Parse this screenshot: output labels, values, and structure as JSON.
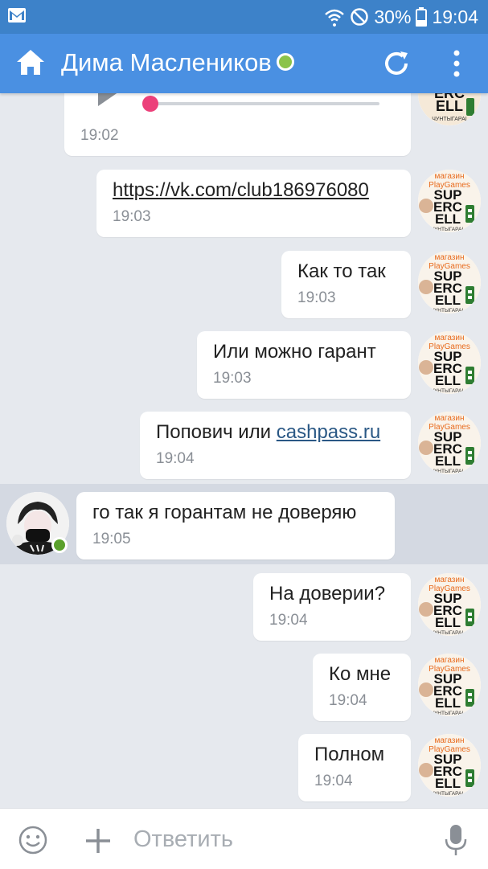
{
  "status_bar": {
    "battery": "30%",
    "time": "19:04"
  },
  "header": {
    "title": "Дима Маслеников"
  },
  "avatar_shop": {
    "line1": "магазин",
    "line2": "PlayGames",
    "line3": "SUP",
    "line4": "ERC",
    "line5": "ELL",
    "line6": "ЧУНТЫГАРАІ"
  },
  "messages": [
    {
      "time": "19:02",
      "type": "voice"
    },
    {
      "text": "https://vk.com/club186976080",
      "time": "19:03"
    },
    {
      "text": "Как то так",
      "time": "19:03"
    },
    {
      "text": "Или можно гарант",
      "time": "19:03"
    },
    {
      "text_before": "Попович или ",
      "link": "cashpass.ru",
      "time": "19:04"
    },
    {
      "text": "го так я горантам не доверяю",
      "time": "19:05"
    },
    {
      "text": "На доверии?",
      "time": "19:04"
    },
    {
      "text": "Ко мне",
      "time": "19:04"
    },
    {
      "text": "Полном",
      "time": "19:04"
    }
  ],
  "composer": {
    "placeholder": "Ответить"
  },
  "colors": {
    "statusbar": "#3d82c9",
    "appbar": "#4a90e2",
    "online": "#8bc34a",
    "voice_dot": "#ec407a",
    "link": "#2a5885"
  }
}
